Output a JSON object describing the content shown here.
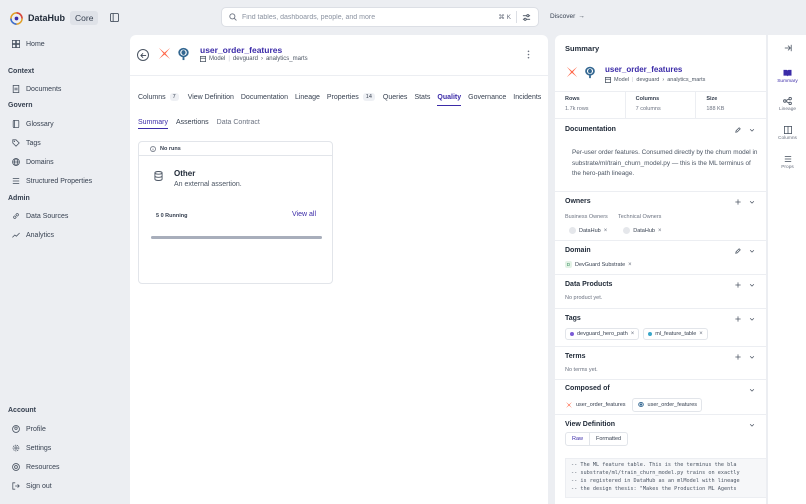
{
  "app": {
    "name": "DataHub",
    "edition": "Core"
  },
  "search": {
    "placeholder": "Find tables, dashboards, people, and more",
    "shortcut": "⌘ K"
  },
  "discover_label": "Discover",
  "sidebar": {
    "home": "Home",
    "context_section": "Context",
    "documents": "Documents",
    "govern_section": "Govern",
    "glossary": "Glossary",
    "tags": "Tags",
    "domains": "Domains",
    "structured_properties": "Structured Properties",
    "admin_section": "Admin",
    "data_sources": "Data Sources",
    "analytics": "Analytics",
    "account_section": "Account",
    "profile": "Profile",
    "settings": "Settings",
    "resources": "Resources",
    "sign_out": "Sign out"
  },
  "entity": {
    "title": "user_order_features",
    "type": "Model",
    "platform": "devguard",
    "container": "analytics_marts"
  },
  "tabs": [
    {
      "label": "Columns",
      "count": "7"
    },
    {
      "label": "View Definition"
    },
    {
      "label": "Documentation"
    },
    {
      "label": "Lineage"
    },
    {
      "label": "Properties",
      "count": "14"
    },
    {
      "label": "Queries"
    },
    {
      "label": "Stats"
    },
    {
      "label": "Quality"
    },
    {
      "label": "Governance"
    },
    {
      "label": "Incidents"
    }
  ],
  "active_tab": "Quality",
  "subtabs": [
    "Summary",
    "Assertions",
    "Data Contract"
  ],
  "assertion_card": {
    "status": "No runs",
    "kind": "Other",
    "description": "An external assertion.",
    "running": "5 0 Running",
    "view_all": "View all",
    "progress_fraction": 1.0
  },
  "summary": {
    "title": "Summary",
    "stats": [
      {
        "label": "Rows",
        "value": "1.7k rows"
      },
      {
        "label": "Columns",
        "value": "7 columns"
      },
      {
        "label": "Size",
        "value": "188 KB"
      }
    ],
    "documentation": {
      "heading": "Documentation",
      "text": "Per-user order features. Consumed directly by the churn model in substrate/ml/train_churn_model.py — this is the ML terminus of the hero-path lineage."
    },
    "owners": {
      "heading": "Owners",
      "business_label": "Business Owners",
      "technical_label": "Technical Owners",
      "business_owner": "DataHub",
      "technical_owner": "DataHub"
    },
    "domain": {
      "heading": "Domain",
      "value": "DevGuard Substrate",
      "initial": "D"
    },
    "data_products": {
      "heading": "Data Products",
      "empty": "No product yet."
    },
    "tags": {
      "heading": "Tags",
      "items": [
        "devguard_hero_path",
        "ml_feature_table"
      ],
      "colors": [
        "#7c5cd6",
        "#3ba7c9"
      ]
    },
    "terms": {
      "heading": "Terms",
      "empty": "No terms yet."
    },
    "composed_of": {
      "heading": "Composed of",
      "items": [
        "user_order_features",
        "user_order_features"
      ]
    },
    "view_definition": {
      "heading": "View Definition",
      "raw_label": "Raw",
      "formatted_label": "Formatted",
      "code": "-- The ML feature table. This is the terminus the bla\n-- substrate/ml/train_churn_model.py trains on exactly\n-- is registered in DataHub as an mlModel with lineage\n-- the design thesis: \"Makes the Production ML Agents"
    }
  },
  "rail": [
    "Summary",
    "Lineage",
    "Columns",
    "Props"
  ],
  "colors": {
    "accent": "#3b2ba8",
    "background": "#eceef2"
  }
}
